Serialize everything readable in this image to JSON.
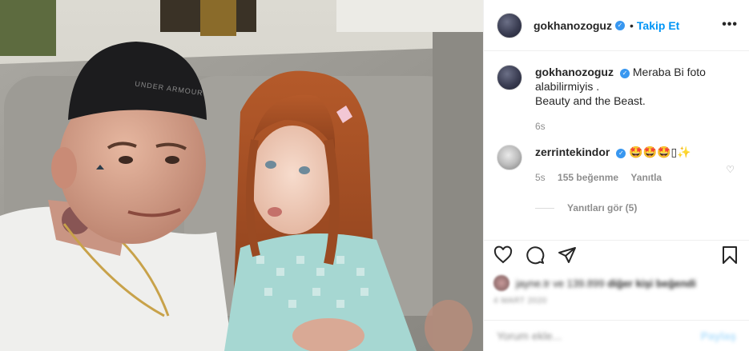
{
  "post": {
    "author": "gokhanozoguz",
    "follow_label": "Takip Et",
    "dot": "•",
    "more": "•••"
  },
  "caption": {
    "author": "gokhanozoguz",
    "text_line1": "Meraba Bi foto alabilirmiyis .",
    "text_line2": "Beauty and the Beast.",
    "time": "6s"
  },
  "comment": {
    "author": "zerrintekindor",
    "emojis": "🤩🤩🤩▯✨",
    "time": "5s",
    "likes": "155 beğenme",
    "reply_label": "Yanıtla",
    "view_replies": "Yanıtları gör (5)"
  },
  "likes_line": {
    "who": "jayne.tr ve 139.899",
    "rest": "diğer kişi beğendi"
  },
  "date": "4 MART 2020",
  "add_comment": {
    "placeholder": "Yorum ekle...",
    "post_label": "Paylaş"
  },
  "colors": {
    "accent": "#0095f6",
    "verified": "#3897f0",
    "muted": "#8e8e8e"
  },
  "icons": [
    "heart-icon",
    "comment-icon",
    "share-icon",
    "bookmark-icon",
    "more-icon",
    "verified-icon"
  ]
}
